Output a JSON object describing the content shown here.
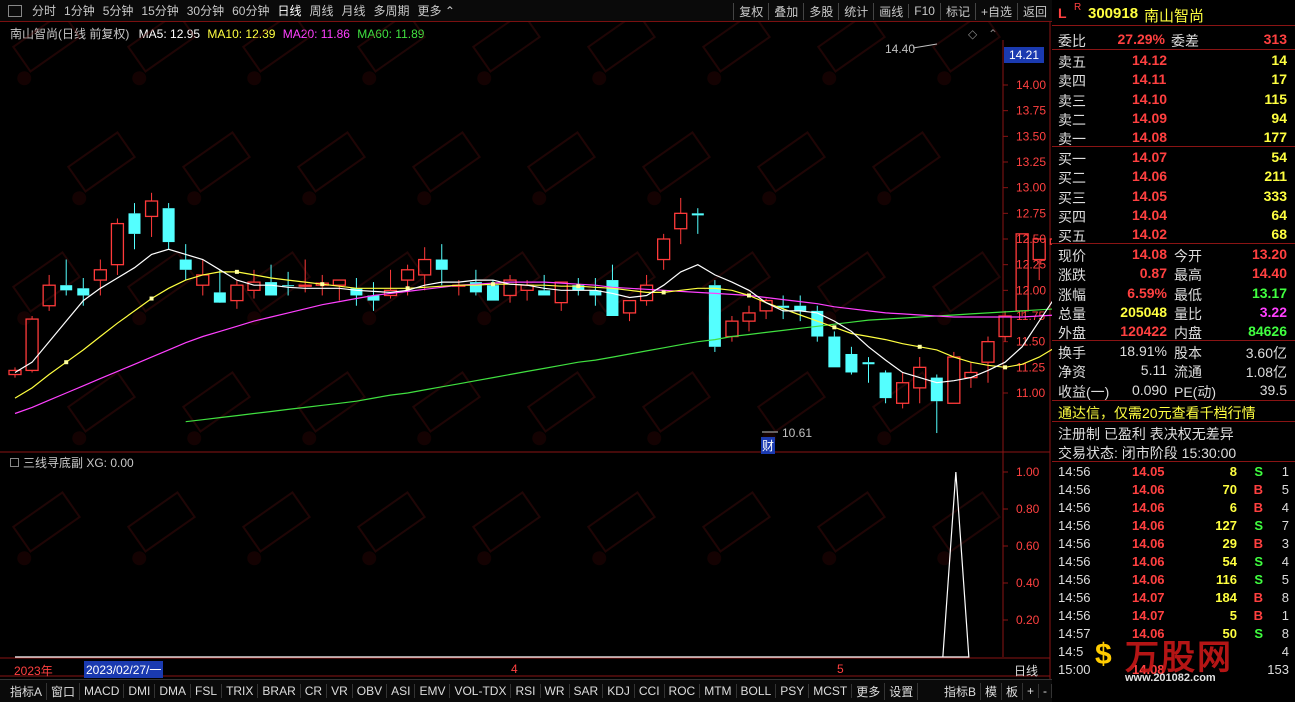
{
  "toolbar": {
    "periods": [
      "分时",
      "1分钟",
      "5分钟",
      "15分钟",
      "30分钟",
      "60分钟",
      "日线",
      "周线",
      "月线",
      "多周期",
      "更多"
    ],
    "right_buttons": [
      "复权",
      "叠加",
      "多股",
      "统计",
      "画线",
      "F10",
      "标记",
      "+自选",
      "返回"
    ]
  },
  "chart_header": {
    "title": "南山智尚(日线 前复权)",
    "ma5": "MA5: 12.95",
    "ma10": "MA10: 12.39",
    "ma20": "MA20: 11.86",
    "ma60": "MA60: 11.89"
  },
  "price_axis": [
    "14.00",
    "13.75",
    "13.50",
    "13.25",
    "13.00",
    "12.75",
    "12.50",
    "12.25",
    "12.00",
    "11.75",
    "11.50",
    "11.25",
    "11.00"
  ],
  "price_tag": "14.21",
  "high_label": "14.40",
  "low_label": "10.61",
  "event_marker": "财",
  "indicator": {
    "header": "三线寻底副 XG: 0.00",
    "axis": [
      "1.00",
      "0.80",
      "0.60",
      "0.40",
      "0.20"
    ]
  },
  "date_bar": {
    "year": "2023年",
    "cursor_date": "2023/02/27/一",
    "month4": "4",
    "month5": "5",
    "period": "日线"
  },
  "bottom_tabs": [
    "指标A",
    "窗口",
    "MACD",
    "DMI",
    "DMA",
    "FSL",
    "TRIX",
    "BRAR",
    "CR",
    "VR",
    "OBV",
    "ASI",
    "EMV",
    "VOL-TDX",
    "RSI",
    "WR",
    "SAR",
    "KDJ",
    "CCI",
    "ROC",
    "MTM",
    "BOLL",
    "PSY",
    "MCST",
    "更多",
    "设置"
  ],
  "bottom_right": [
    "指标B",
    "模",
    "板",
    "+",
    "-"
  ],
  "quote": {
    "header_l": "L",
    "header_r": "R",
    "code": "300918",
    "name": "南山智尚",
    "weibi_label": "委比",
    "weibi_val": "27.29%",
    "weicha_label": "委差",
    "weicha_val": "313",
    "asks": [
      {
        "label": "卖五",
        "price": "14.12",
        "vol": "14"
      },
      {
        "label": "卖四",
        "price": "14.11",
        "vol": "17"
      },
      {
        "label": "卖三",
        "price": "14.10",
        "vol": "115"
      },
      {
        "label": "卖二",
        "price": "14.09",
        "vol": "94"
      },
      {
        "label": "卖一",
        "price": "14.08",
        "vol": "177"
      }
    ],
    "bids": [
      {
        "label": "买一",
        "price": "14.07",
        "vol": "54"
      },
      {
        "label": "买二",
        "price": "14.06",
        "vol": "211"
      },
      {
        "label": "买三",
        "price": "14.05",
        "vol": "333"
      },
      {
        "label": "买四",
        "price": "14.04",
        "vol": "64"
      },
      {
        "label": "买五",
        "price": "14.02",
        "vol": "68"
      }
    ],
    "stats": [
      {
        "l1": "现价",
        "v1": "14.08",
        "l2": "今开",
        "v2": "13.20",
        "c1": "#ff4040",
        "c2": "#ff4040"
      },
      {
        "l1": "涨跌",
        "v1": "0.87",
        "l2": "最高",
        "v2": "14.40",
        "c1": "#ff4040",
        "c2": "#ff4040"
      },
      {
        "l1": "涨幅",
        "v1": "6.59%",
        "l2": "最低",
        "v2": "13.17",
        "c1": "#ff4040",
        "c2": "#40ff40"
      },
      {
        "l1": "总量",
        "v1": "205048",
        "l2": "量比",
        "v2": "3.22",
        "c1": "#ffff40",
        "c2": "#ff40ff"
      },
      {
        "l1": "外盘",
        "v1": "120422",
        "l2": "内盘",
        "v2": "84626",
        "c1": "#ff4040",
        "c2": "#40ff40"
      }
    ],
    "stats2": [
      {
        "l1": "换手",
        "v1": "18.91%",
        "l2": "股本",
        "v2": "3.60亿"
      },
      {
        "l1": "净资",
        "v1": "5.11",
        "l2": "流通",
        "v2": "1.08亿"
      },
      {
        "l1": "收益(一)",
        "v1": "0.090",
        "l2": "PE(动)",
        "v2": "39.5"
      }
    ],
    "promo": "通达信，仅需20元查看千档行情",
    "info": "注册制 已盈利 表决权无差异",
    "status": "交易状态: 闭市阶段 15:30:00",
    "ticks": [
      {
        "time": "14:56",
        "price": "14.05",
        "vol": "8",
        "bs": "S",
        "n": "1"
      },
      {
        "time": "14:56",
        "price": "14.06",
        "vol": "70",
        "bs": "B",
        "n": "5"
      },
      {
        "time": "14:56",
        "price": "14.06",
        "vol": "6",
        "bs": "B",
        "n": "4"
      },
      {
        "time": "14:56",
        "price": "14.06",
        "vol": "127",
        "bs": "S",
        "n": "7"
      },
      {
        "time": "14:56",
        "price": "14.06",
        "vol": "29",
        "bs": "B",
        "n": "3"
      },
      {
        "time": "14:56",
        "price": "14.06",
        "vol": "54",
        "bs": "S",
        "n": "4"
      },
      {
        "time": "14:56",
        "price": "14.06",
        "vol": "116",
        "bs": "S",
        "n": "5"
      },
      {
        "time": "14:56",
        "price": "14.07",
        "vol": "184",
        "bs": "B",
        "n": "8"
      },
      {
        "time": "14:56",
        "price": "14.07",
        "vol": "5",
        "bs": "B",
        "n": "1"
      },
      {
        "time": "14:57",
        "price": "14.06",
        "vol": "50",
        "bs": "S",
        "n": "8"
      },
      {
        "time": "14:5",
        "price": "",
        "vol": "",
        "bs": "",
        "n": "4"
      },
      {
        "time": "15:00",
        "price": "14.08",
        "vol": "",
        "bs": "",
        "n": "153"
      }
    ]
  },
  "watermark": {
    "brand": "万股网",
    "url": "www.201082.com"
  },
  "colors": {
    "up": "#ff3a3a",
    "down": "#54ffff",
    "ma5": "#ffffff",
    "ma10": "#ffff40",
    "ma20": "#ff40ff",
    "ma60": "#40e040",
    "frame": "#8a1414"
  },
  "chart_data": {
    "type": "candlestick",
    "candles": [
      [
        11.18,
        11.25,
        11.15,
        11.22
      ],
      [
        11.22,
        11.75,
        11.2,
        11.72
      ],
      [
        11.85,
        12.15,
        11.8,
        12.05
      ],
      [
        12.05,
        12.3,
        11.95,
        12.0
      ],
      [
        12.02,
        12.12,
        11.85,
        11.95
      ],
      [
        12.1,
        12.3,
        11.95,
        12.2
      ],
      [
        12.25,
        12.7,
        12.15,
        12.65
      ],
      [
        12.75,
        12.85,
        12.4,
        12.55
      ],
      [
        12.72,
        12.95,
        12.52,
        12.87
      ],
      [
        12.8,
        12.85,
        12.4,
        12.47
      ],
      [
        12.3,
        12.45,
        12.1,
        12.2
      ],
      [
        12.05,
        12.3,
        11.95,
        12.15
      ],
      [
        11.98,
        12.2,
        11.9,
        11.88
      ],
      [
        11.9,
        12.1,
        11.82,
        12.05
      ],
      [
        12.0,
        12.2,
        11.92,
        12.08
      ],
      [
        12.08,
        12.25,
        11.95,
        11.95
      ],
      [
        12.05,
        12.18,
        11.95,
        12.04
      ],
      [
        12.04,
        12.3,
        11.98,
        12.05
      ],
      [
        12.05,
        12.15,
        11.95,
        12.07
      ],
      [
        12.05,
        12.1,
        11.9,
        12.1
      ],
      [
        12.02,
        12.12,
        11.85,
        11.95
      ],
      [
        11.95,
        12.08,
        11.8,
        11.9
      ],
      [
        11.95,
        12.2,
        11.92,
        12.0
      ],
      [
        12.1,
        12.25,
        11.95,
        12.2
      ],
      [
        12.15,
        12.42,
        12.0,
        12.3
      ],
      [
        12.3,
        12.45,
        12.05,
        12.2
      ],
      [
        12.05,
        12.1,
        11.95,
        12.05
      ],
      [
        12.08,
        12.2,
        11.95,
        11.98
      ],
      [
        12.05,
        12.1,
        11.9,
        11.9
      ],
      [
        11.95,
        12.15,
        11.88,
        12.1
      ],
      [
        12.0,
        12.1,
        11.9,
        12.05
      ],
      [
        12.0,
        12.15,
        11.95,
        11.95
      ],
      [
        11.88,
        12.08,
        11.8,
        12.08
      ],
      [
        12.05,
        12.12,
        11.95,
        12.0
      ],
      [
        12.0,
        12.12,
        11.85,
        11.95
      ],
      [
        12.1,
        12.25,
        11.98,
        11.75
      ],
      [
        11.78,
        11.9,
        11.7,
        11.9
      ],
      [
        11.9,
        12.15,
        11.85,
        12.05
      ],
      [
        12.3,
        12.55,
        12.2,
        12.5
      ],
      [
        12.6,
        12.9,
        12.45,
        12.75
      ],
      [
        12.75,
        12.8,
        12.55,
        12.73
      ],
      [
        12.05,
        12.1,
        11.4,
        11.45
      ],
      [
        11.55,
        11.75,
        11.5,
        11.7
      ],
      [
        11.7,
        11.85,
        11.6,
        11.78
      ],
      [
        11.8,
        11.92,
        11.72,
        11.9
      ],
      [
        11.85,
        11.95,
        11.72,
        11.83
      ],
      [
        11.85,
        11.95,
        11.7,
        11.8
      ],
      [
        11.8,
        11.85,
        11.5,
        11.55
      ],
      [
        11.55,
        11.6,
        11.25,
        11.25
      ],
      [
        11.38,
        11.45,
        11.18,
        11.2
      ],
      [
        11.3,
        11.35,
        11.1,
        11.28
      ],
      [
        11.2,
        11.22,
        10.9,
        10.95
      ],
      [
        10.9,
        11.2,
        10.85,
        11.1
      ],
      [
        11.05,
        11.35,
        10.9,
        11.25
      ],
      [
        11.15,
        11.18,
        10.61,
        10.92
      ],
      [
        10.9,
        11.4,
        10.9,
        11.35
      ],
      [
        11.15,
        11.3,
        11.05,
        11.2
      ],
      [
        11.3,
        11.55,
        11.1,
        11.5
      ],
      [
        11.55,
        11.8,
        11.5,
        11.75
      ],
      [
        11.8,
        12.55,
        11.75,
        12.55
      ],
      [
        12.3,
        12.5,
        12.1,
        12.5
      ],
      [
        12.45,
        12.6,
        12.4,
        12.5
      ],
      [
        12.4,
        12.6,
        12.35,
        12.45
      ],
      [
        12.45,
        12.6,
        12.4,
        12.45
      ],
      [
        12.3,
        12.65,
        12.25,
        12.6
      ],
      [
        12.6,
        13.15,
        12.55,
        13.15
      ],
      [
        13.2,
        14.4,
        13.17,
        14.08
      ]
    ],
    "ma5": [
      11.2,
      11.3,
      11.5,
      11.7,
      11.9,
      12.02,
      12.12,
      12.22,
      12.35,
      12.4,
      12.35,
      12.3,
      12.2,
      12.1,
      12.05,
      12.05,
      12.03,
      12.02,
      12.02,
      12.02,
      12.0,
      11.99,
      11.98,
      12.0,
      12.05,
      12.08,
      12.08,
      12.1,
      12.1,
      12.06,
      12.05,
      12.02,
      12.0,
      12.0,
      12.0,
      11.97,
      11.93,
      11.95,
      12.05,
      12.18,
      12.25,
      12.15,
      12.08,
      12.0,
      11.88,
      11.8,
      11.8,
      11.78,
      11.7,
      11.6,
      11.45,
      11.32,
      11.2,
      11.15,
      11.1,
      11.12,
      11.15,
      11.22,
      11.3,
      11.45,
      11.7,
      11.95,
      12.15,
      12.3,
      12.45,
      12.65,
      12.95
    ],
    "ma10": [
      10.95,
      11.05,
      11.18,
      11.3,
      11.42,
      11.55,
      11.68,
      11.8,
      11.92,
      12.02,
      12.1,
      12.15,
      12.18,
      12.18,
      12.15,
      12.12,
      12.1,
      12.08,
      12.06,
      12.04,
      12.02,
      12.02,
      12.02,
      12.02,
      12.03,
      12.04,
      12.05,
      12.05,
      12.06,
      12.06,
      12.05,
      12.05,
      12.04,
      12.04,
      12.03,
      12.02,
      12.0,
      11.98,
      11.98,
      12.0,
      12.02,
      12.02,
      12.0,
      11.95,
      11.88,
      11.82,
      11.76,
      11.7,
      11.64,
      11.58,
      11.55,
      11.52,
      11.48,
      11.45,
      11.42,
      11.35,
      11.3,
      11.27,
      11.25,
      11.28,
      11.35,
      11.45,
      11.58,
      11.72,
      11.86,
      12.05,
      12.39
    ],
    "ma20": [
      10.8,
      10.86,
      10.93,
      11.0,
      11.07,
      11.14,
      11.21,
      11.28,
      11.35,
      11.42,
      11.49,
      11.55,
      11.6,
      11.65,
      11.7,
      11.74,
      11.78,
      11.82,
      11.86,
      11.89,
      11.92,
      11.95,
      11.97,
      11.99,
      12.01,
      12.03,
      12.05,
      12.06,
      12.07,
      12.08,
      12.08,
      12.08,
      12.07,
      12.06,
      12.05,
      12.03,
      12.02,
      12.01,
      12.0,
      11.99,
      11.98,
      11.97,
      11.96,
      11.95,
      11.93,
      11.91,
      11.89,
      11.87,
      11.84,
      11.82,
      11.8,
      11.78,
      11.77,
      11.76,
      11.75,
      11.74,
      11.74,
      11.74,
      11.74,
      11.74,
      11.75,
      11.76,
      11.77,
      11.78,
      11.75,
      11.78,
      11.86
    ],
    "ma60": [
      null,
      null,
      null,
      null,
      null,
      null,
      null,
      null,
      null,
      null,
      10.72,
      10.74,
      10.76,
      10.78,
      10.8,
      10.82,
      10.84,
      10.86,
      10.88,
      10.9,
      10.92,
      10.95,
      10.98,
      11.0,
      11.03,
      11.06,
      11.09,
      11.12,
      11.15,
      11.18,
      11.21,
      11.24,
      11.27,
      11.3,
      11.32,
      11.35,
      11.38,
      11.41,
      11.44,
      11.47,
      11.5,
      11.52,
      11.55,
      11.57,
      11.59,
      11.61,
      11.63,
      11.65,
      11.67,
      11.69,
      11.71,
      11.72,
      11.73,
      11.74,
      11.75,
      11.76,
      11.77,
      11.78,
      11.79,
      11.8,
      11.81,
      11.82,
      11.83,
      11.84,
      11.85,
      11.87,
      11.89
    ],
    "xg": {
      "ylim": [
        0,
        1
      ],
      "peak_index": 55,
      "peak_value": 1.0
    },
    "ylim": [
      10.7,
      14.45
    ]
  }
}
